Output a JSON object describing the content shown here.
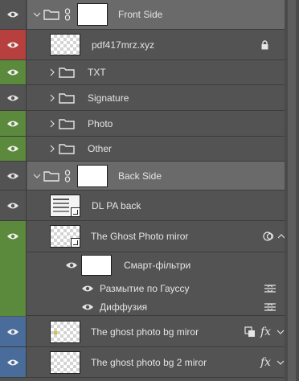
{
  "panel": {
    "colors": {
      "panel_bg": "#535353",
      "selected_row": "#6a6a6a",
      "eye_red": "#b7403e",
      "eye_green": "#5c8a3c",
      "eye_blue": "#4a6c9a"
    },
    "layers": [
      {
        "id": "front-side",
        "label": "Front Side",
        "kind": "group",
        "expanded": true,
        "eye_color": "none",
        "selected": true
      },
      {
        "id": "pdf417",
        "label": "pdf417mrz.xyz",
        "kind": "layer",
        "eye_color": "red",
        "locked": true,
        "lock_icon": "lock-icon"
      },
      {
        "id": "txt",
        "label": "TXT",
        "kind": "group",
        "expanded": false,
        "eye_color": "green"
      },
      {
        "id": "signature",
        "label": "Signature",
        "kind": "group",
        "expanded": false,
        "eye_color": "none"
      },
      {
        "id": "photo",
        "label": "Photo",
        "kind": "group",
        "expanded": false,
        "eye_color": "green"
      },
      {
        "id": "other",
        "label": "Other",
        "kind": "group",
        "expanded": false,
        "eye_color": "green"
      },
      {
        "id": "back-side",
        "label": "Back Side",
        "kind": "group",
        "expanded": true,
        "eye_color": "none",
        "selected": true
      },
      {
        "id": "dl-pa-back",
        "label": "DL PA back",
        "kind": "smart-object",
        "eye_color": "none"
      },
      {
        "id": "ghost-miror",
        "label": "The Ghost Photo miror",
        "kind": "smart-object",
        "eye_color": "green"
      },
      {
        "id": "smart-filters",
        "label": "Смарт-фільтри",
        "kind": "smart-filters"
      },
      {
        "id": "gauss",
        "label": "Размытие по Гауссу",
        "kind": "filter"
      },
      {
        "id": "diffuse",
        "label": "Диффузия",
        "kind": "filter"
      },
      {
        "id": "ghost-bg",
        "label": "The ghost photo bg miror",
        "kind": "layer",
        "eye_color": "blue",
        "fx": "fx"
      },
      {
        "id": "ghost-bg2",
        "label": "The ghost photo bg 2 miror",
        "kind": "layer",
        "eye_color": "blue",
        "fx": "fx"
      }
    ]
  }
}
